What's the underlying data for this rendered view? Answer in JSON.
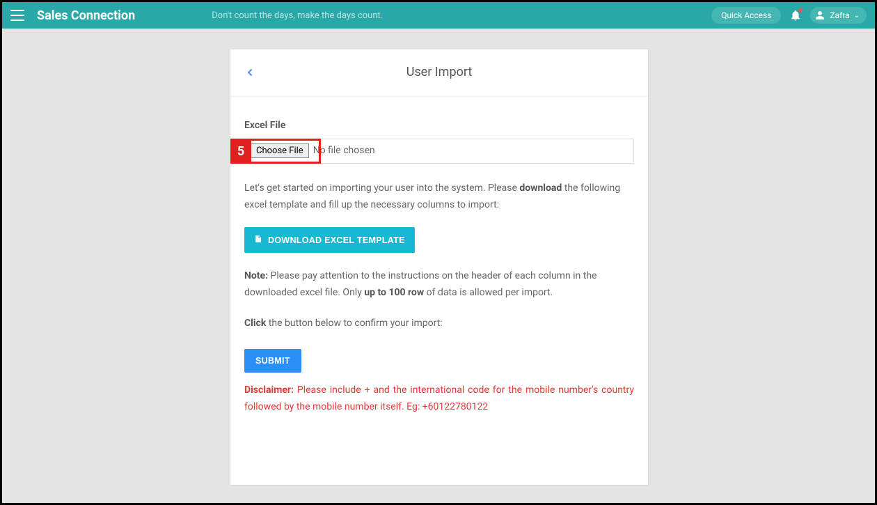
{
  "header": {
    "brand": "Sales Connection",
    "tagline": "Don't count the days, make the days count.",
    "quick_access": "Quick Access",
    "user_name": "Zafra"
  },
  "card": {
    "title": "User Import",
    "excel_file_label": "Excel File",
    "choose_file_label": "Choose File",
    "no_file_text": "No file chosen",
    "intro_pre": "Let's get started on importing your user into the system. Please ",
    "intro_bold": "download",
    "intro_post": " the following excel template and fill up the necessary columns to import:",
    "download_btn": "DOWNLOAD EXCEL TEMPLATE",
    "note_label": "Note:",
    "note_text_pre": " Please pay attention to the instructions on the header of each column in the downloaded excel file. Only ",
    "note_bold": "up to 100 row",
    "note_text_post": " of data is allowed per import.",
    "click_label": "Click",
    "click_text": " the button below to confirm your import:",
    "submit_btn": "SUBMIT",
    "disclaimer_label": "Disclaimer:",
    "disclaimer_text": " Please include + and the international code for the mobile number's country followed by the mobile number itself. Eg: +60122780122"
  },
  "annotation": {
    "step_number": "5"
  }
}
